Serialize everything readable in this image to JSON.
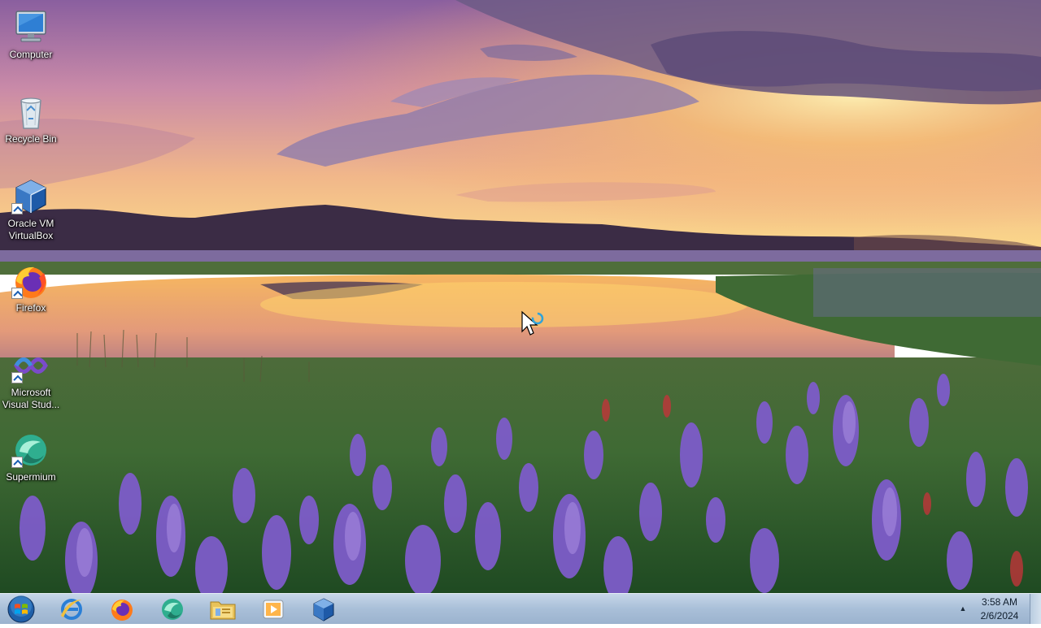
{
  "desktop": {
    "icons": [
      {
        "label": "Computer",
        "icon": "computer-icon",
        "shortcut": false
      },
      {
        "label": "Recycle Bin",
        "icon": "recycle-bin-icon",
        "shortcut": false
      },
      {
        "label": "Oracle VM VirtualBox",
        "icon": "virtualbox-icon",
        "shortcut": true
      },
      {
        "label": "Firefox",
        "icon": "firefox-icon",
        "shortcut": true
      },
      {
        "label": "Microsoft Visual Stud...",
        "icon": "visual-studio-icon",
        "shortcut": true
      },
      {
        "label": "Supermium",
        "icon": "supermium-icon",
        "shortcut": true
      }
    ]
  },
  "taskbar": {
    "start": {
      "icon": "windows-start-orb-icon"
    },
    "pinned": [
      {
        "icon": "internet-explorer-icon"
      },
      {
        "icon": "firefox-icon"
      },
      {
        "icon": "supermium-icon"
      },
      {
        "icon": "file-explorer-icon"
      },
      {
        "icon": "media-player-icon"
      },
      {
        "icon": "virtualbox-icon"
      }
    ],
    "tray": {
      "overflow_arrow": "▲",
      "time": "3:58 AM",
      "date": "2/6/2024"
    }
  },
  "colors": {
    "taskbar_top": "#c6d6e8",
    "taskbar_bottom": "#9bb3ce",
    "clock_text": "#0f1d2c"
  }
}
